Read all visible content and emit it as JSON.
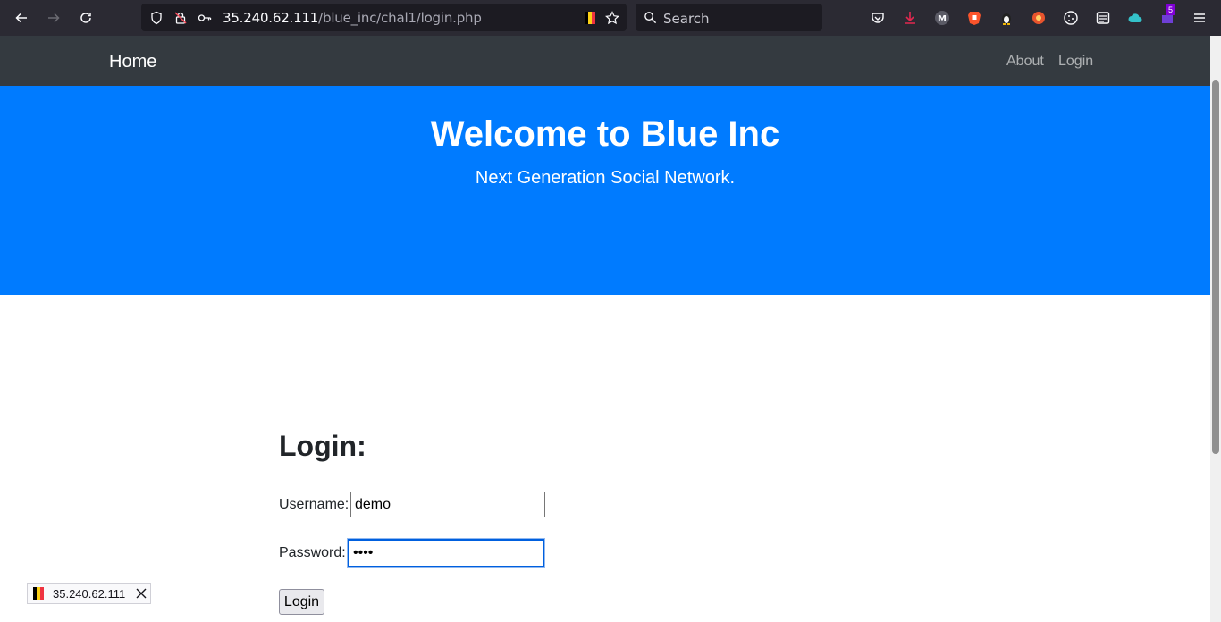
{
  "browser": {
    "url_host": "35.240.62.111",
    "url_path": "/blue_inc/chal1/login.php",
    "search_placeholder": "Search",
    "extension_badge": "5"
  },
  "navbar": {
    "brand": "Home",
    "links": [
      "About",
      "Login"
    ]
  },
  "hero": {
    "title": "Welcome to Blue Inc",
    "subtitle": "Next Generation Social Network."
  },
  "login": {
    "title": "Login:",
    "username_label": "Username:",
    "username_value": "demo",
    "password_label": "Password:",
    "password_value": "demo",
    "button_label": "Login"
  },
  "status_overlay": {
    "host": "35.240.62.111"
  }
}
